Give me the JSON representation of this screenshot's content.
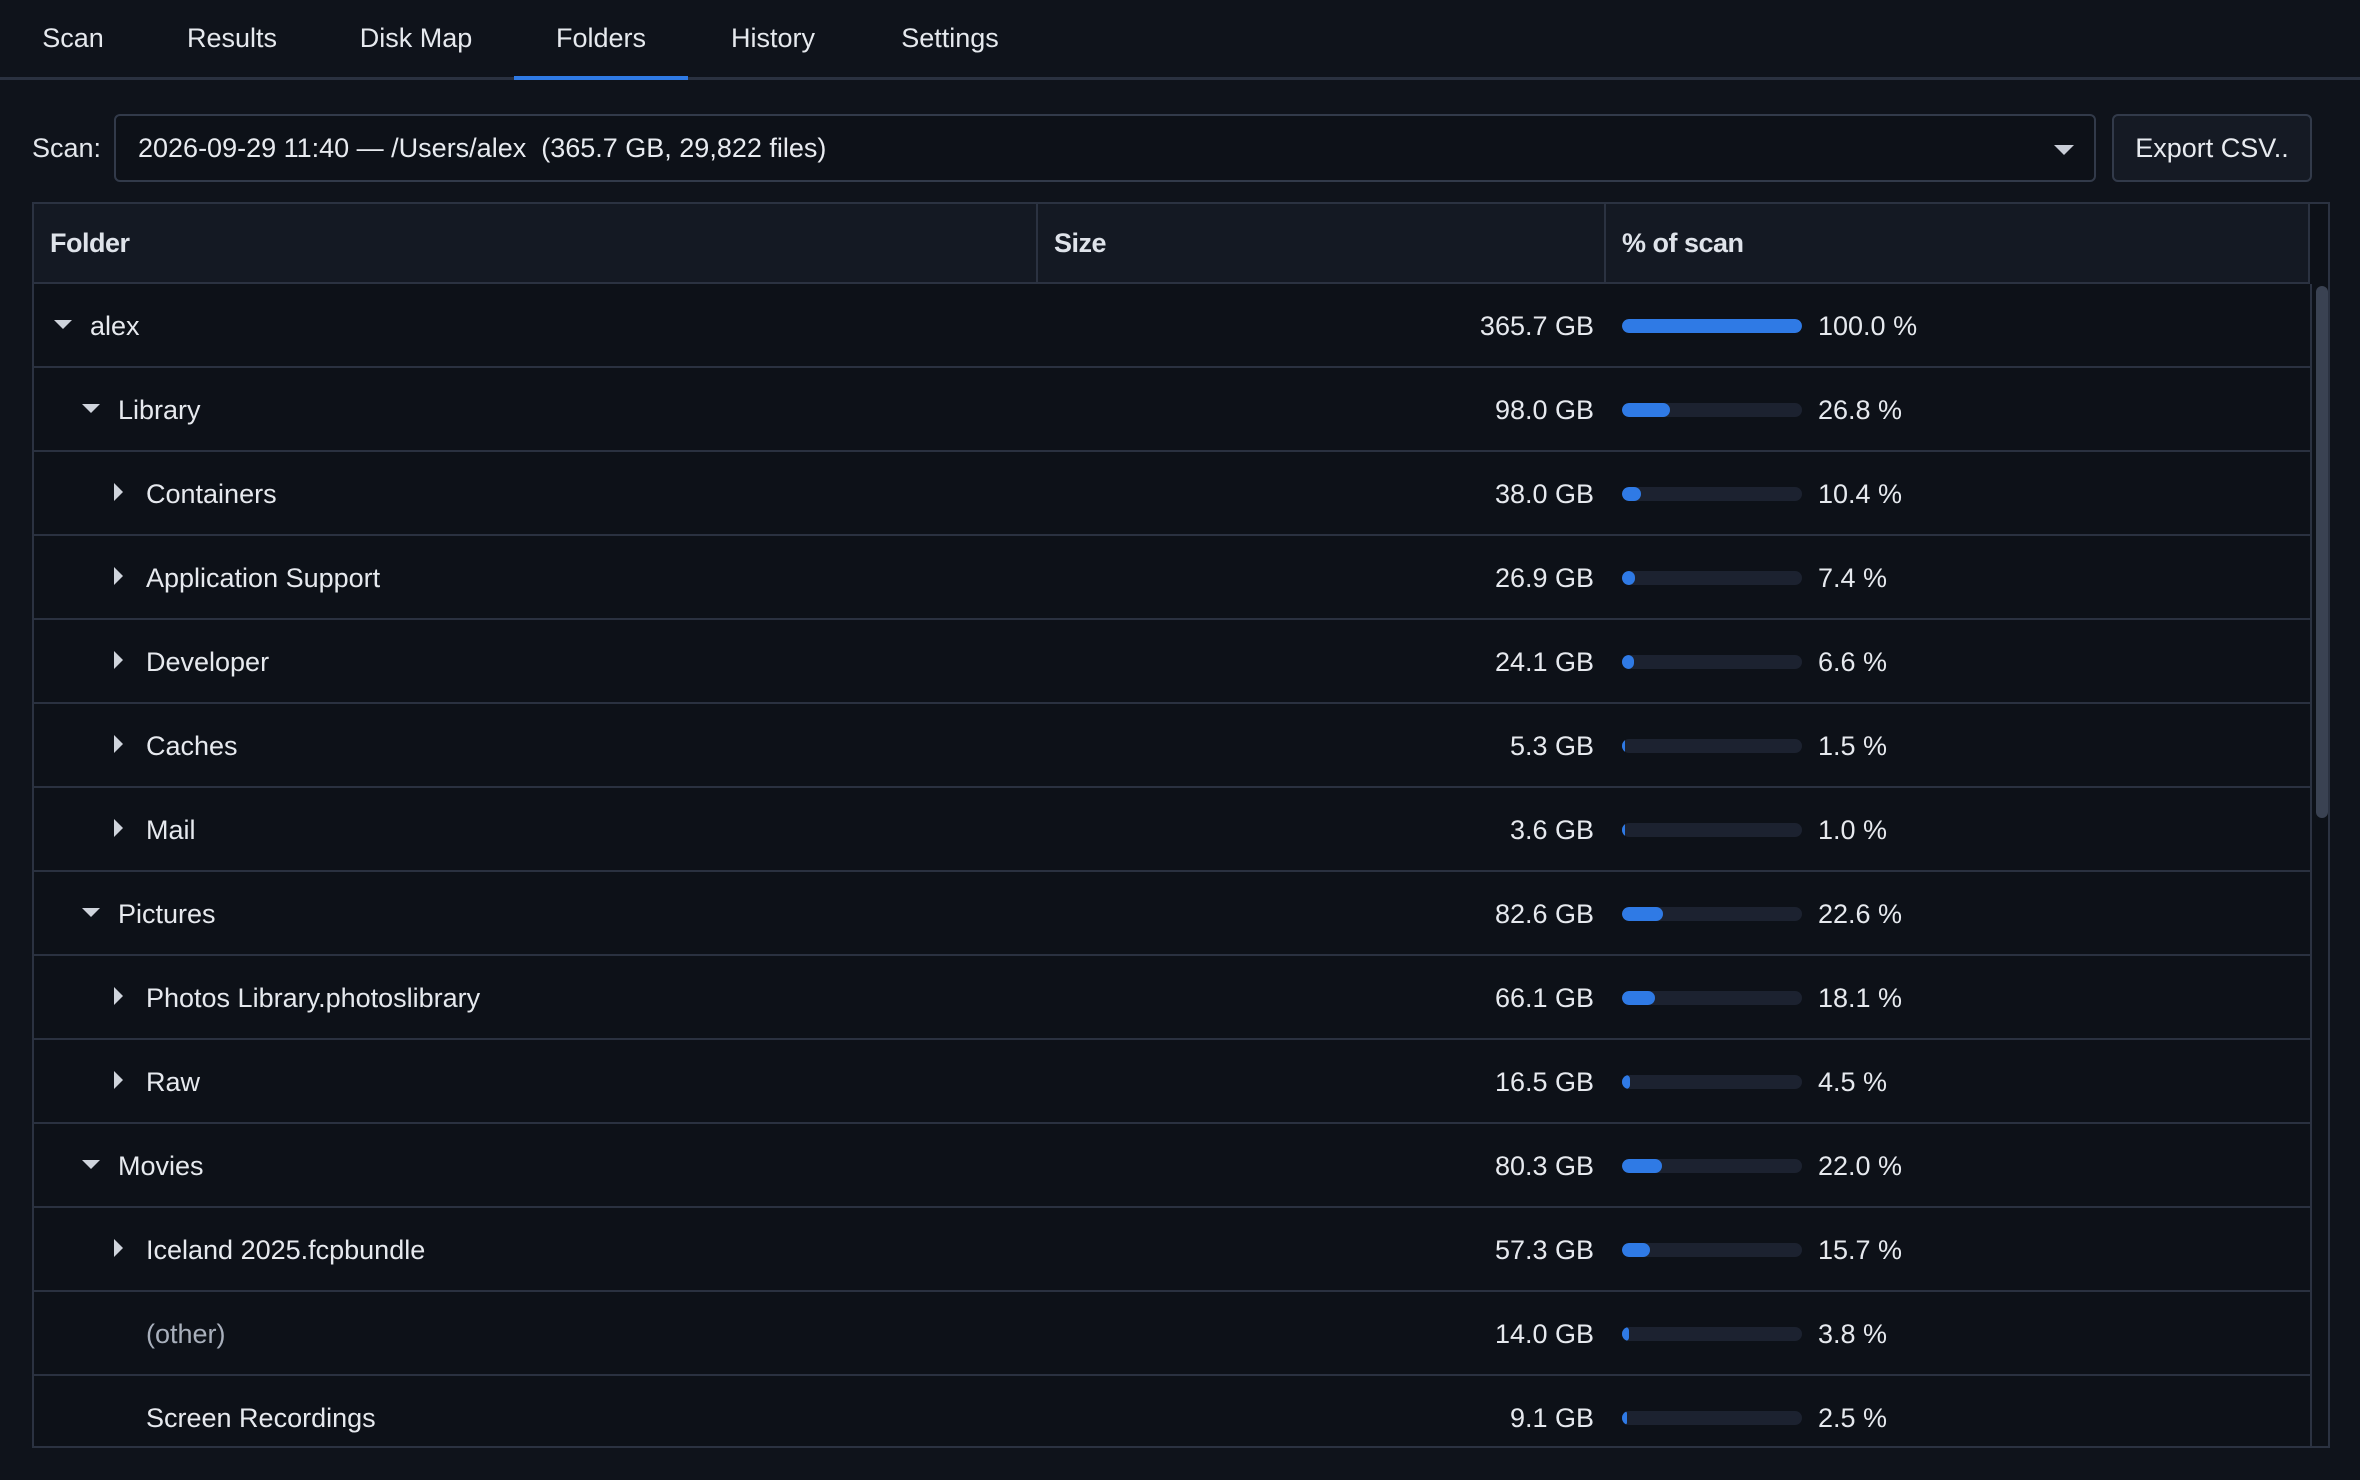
{
  "tabs": [
    {
      "label": "Scan"
    },
    {
      "label": "Results"
    },
    {
      "label": "Disk Map"
    },
    {
      "label": "Folders",
      "active": true
    },
    {
      "label": "History"
    },
    {
      "label": "Settings"
    }
  ],
  "toolbar": {
    "scan_label": "Scan:",
    "scan_selected": "2026-09-29 11:40 — /Users/alex  (365.7 GB, 29,822 files)",
    "export_label": "Export CSV.."
  },
  "table": {
    "headers": {
      "folder": "Folder",
      "size": "Size",
      "percent": "% of scan"
    },
    "rows": [
      {
        "name": "alex",
        "size": "365.7 GB",
        "percent": "100.0 %",
        "fraction": 1.0,
        "depth": 0,
        "expander": "expanded"
      },
      {
        "name": "Library",
        "size": "98.0 GB",
        "percent": "26.8 %",
        "fraction": 0.268,
        "depth": 1,
        "expander": "expanded"
      },
      {
        "name": "Containers",
        "size": "38.0 GB",
        "percent": "10.4 %",
        "fraction": 0.104,
        "depth": 2,
        "expander": "collapsed"
      },
      {
        "name": "Application Support",
        "size": "26.9 GB",
        "percent": "7.4 %",
        "fraction": 0.074,
        "depth": 2,
        "expander": "collapsed"
      },
      {
        "name": "Developer",
        "size": "24.1 GB",
        "percent": "6.6 %",
        "fraction": 0.066,
        "depth": 2,
        "expander": "collapsed"
      },
      {
        "name": "Caches",
        "size": "5.3 GB",
        "percent": "1.5 %",
        "fraction": 0.015,
        "depth": 2,
        "expander": "collapsed"
      },
      {
        "name": "Mail",
        "size": "3.6 GB",
        "percent": "1.0 %",
        "fraction": 0.01,
        "depth": 2,
        "expander": "collapsed"
      },
      {
        "name": "Pictures",
        "size": "82.6 GB",
        "percent": "22.6 %",
        "fraction": 0.226,
        "depth": 1,
        "expander": "expanded"
      },
      {
        "name": "Photos Library.photoslibrary",
        "size": "66.1 GB",
        "percent": "18.1 %",
        "fraction": 0.181,
        "depth": 2,
        "expander": "collapsed"
      },
      {
        "name": "Raw",
        "size": "16.5 GB",
        "percent": "4.5 %",
        "fraction": 0.045,
        "depth": 2,
        "expander": "collapsed"
      },
      {
        "name": "Movies",
        "size": "80.3 GB",
        "percent": "22.0 %",
        "fraction": 0.22,
        "depth": 1,
        "expander": "expanded"
      },
      {
        "name": "Iceland 2025.fcpbundle",
        "size": "57.3 GB",
        "percent": "15.7 %",
        "fraction": 0.157,
        "depth": 2,
        "expander": "collapsed"
      },
      {
        "name": "(other)",
        "size": "14.0 GB",
        "percent": "3.8 %",
        "fraction": 0.038,
        "depth": 2,
        "expander": "none",
        "muted": true
      },
      {
        "name": "Screen Recordings",
        "size": "9.1 GB",
        "percent": "2.5 %",
        "fraction": 0.025,
        "depth": 2,
        "expander": "none"
      }
    ]
  },
  "colors": {
    "accent": "#2f7ae5",
    "background": "#0f131b"
  }
}
